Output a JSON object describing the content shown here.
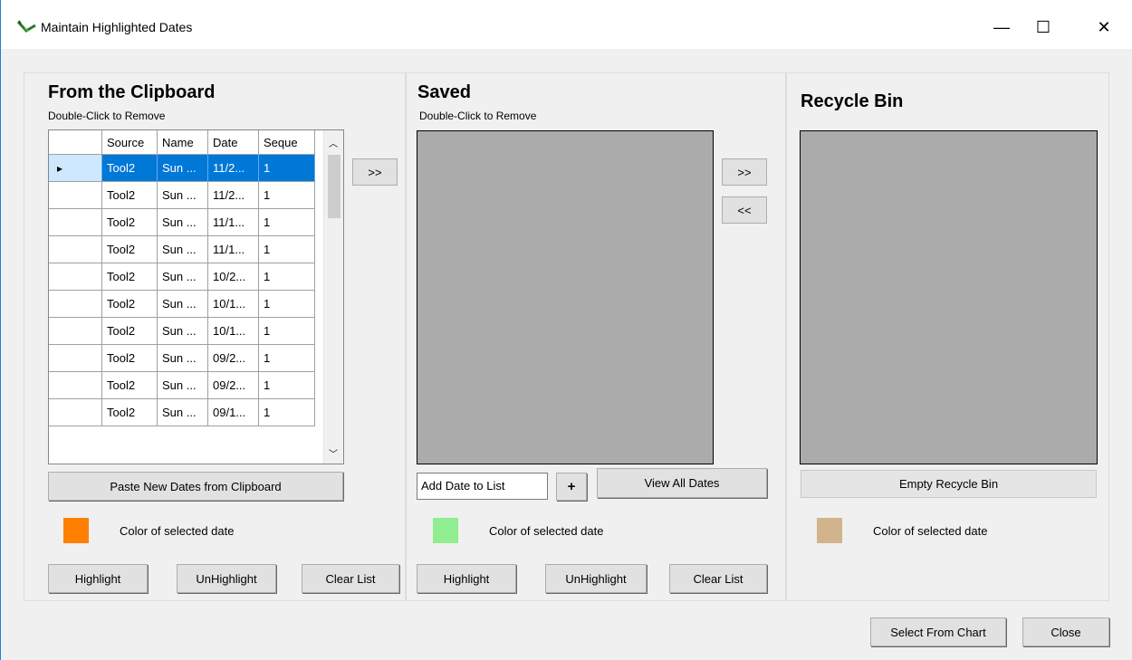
{
  "window": {
    "title": "Maintain Highlighted Dates",
    "minimize_glyph": "—",
    "maximize_glyph": "☐",
    "close_glyph": "✕"
  },
  "clipboard": {
    "heading": "From the Clipboard",
    "subheading": "Double-Click to Remove",
    "columns": [
      "Source",
      "Name",
      "Date",
      "Seque"
    ],
    "rows": [
      [
        "Tool2",
        "Sun ...",
        "11/2...",
        "1"
      ],
      [
        "Tool2",
        "Sun ...",
        "11/2...",
        "1"
      ],
      [
        "Tool2",
        "Sun ...",
        "11/1...",
        "1"
      ],
      [
        "Tool2",
        "Sun ...",
        "11/1...",
        "1"
      ],
      [
        "Tool2",
        "Sun ...",
        "10/2...",
        "1"
      ],
      [
        "Tool2",
        "Sun ...",
        "10/1...",
        "1"
      ],
      [
        "Tool2",
        "Sun ...",
        "10/1...",
        "1"
      ],
      [
        "Tool2",
        "Sun ...",
        "09/2...",
        "1"
      ],
      [
        "Tool2",
        "Sun ...",
        "09/2...",
        "1"
      ],
      [
        "Tool2",
        "Sun ...",
        "09/1...",
        "1"
      ]
    ],
    "selected_row": 0,
    "move_right": ">>",
    "paste_button": "Paste New Dates from Clipboard",
    "color_label": "Color of selected date",
    "color": "#ff8000",
    "highlight": "Highlight",
    "unhighlight": "UnHighlight",
    "clear": "Clear List"
  },
  "saved": {
    "heading": "Saved",
    "subheading": "Double-Click to Remove",
    "move_right": ">>",
    "move_left": "<<",
    "add_date_value": "Add Date to List",
    "add_button": "+",
    "view_all": "View All Dates",
    "color_label": "Color of selected date",
    "color": "#90ee90",
    "highlight": "Highlight",
    "unhighlight": "UnHighlight",
    "clear": "Clear List"
  },
  "recycle": {
    "heading": "Recycle Bin",
    "empty_button": "Empty Recycle Bin",
    "color_label": "Color of selected date",
    "color": "#d2b48c"
  },
  "footer": {
    "select_from_chart": "Select From Chart",
    "close": "Close"
  }
}
